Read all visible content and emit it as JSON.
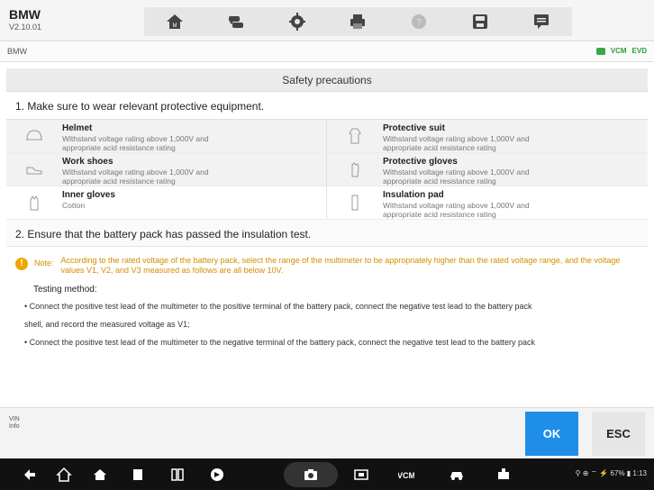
{
  "app": {
    "brand": "BMW",
    "version": "V2.10.01"
  },
  "breadcrumb": "BMW",
  "status": {
    "vci": "VCM",
    "evd": "EVD"
  },
  "toolbar": {
    "icons": [
      "home-icon",
      "vehicle-swap-icon",
      "settings-icon",
      "print-icon",
      "help-icon",
      "save-icon",
      "message-icon"
    ]
  },
  "dialog": {
    "title": "Safety precautions",
    "section1": "1. Make sure to wear relevant protective equipment.",
    "ppe": [
      {
        "title": "Helmet",
        "desc1": "Withstand voltage rating above 1,000V and",
        "desc2": "appropriate acid resistance rating"
      },
      {
        "title": "Protective suit",
        "desc1": "Withstand voltage rating above 1,000V and",
        "desc2": "appropriate acid resistance rating"
      },
      {
        "title": "Work shoes",
        "desc1": "Withstand voltage rating above 1,000V and",
        "desc2": "appropriate acid resistance rating"
      },
      {
        "title": "Protective gloves",
        "desc1": "Withstand voltage rating above 1,000V and",
        "desc2": "appropriate acid resistance rating"
      },
      {
        "title": "Inner gloves",
        "desc1": "Cotton",
        "desc2": ""
      },
      {
        "title": "Insulation pad",
        "desc1": "Withstand voltage rating above 1,000V and",
        "desc2": "appropriate acid resistance rating"
      }
    ],
    "section2": "2. Ensure that the battery pack has passed the insulation test.",
    "note_label": "Note:",
    "note_text": "According to the rated voltage of the battery pack, select the range of the multimeter to be appropriately higher than the rated voltage range, and the voltage values V1, V2, and V3 measured as follows are all below 10V.",
    "method_heading": "Testing method:",
    "step1a": "• Connect the positive test lead of the multimeter to the positive terminal of the battery pack, connect the negative test lead to the battery pack",
    "step1b": "shell, and record the measured voltage as V1;",
    "step2": "• Connect the positive test lead of the multimeter to the negative terminal of the battery pack, connect the negative test lead to the battery pack"
  },
  "footer": {
    "vin_label": "VIN",
    "info_label": "Info",
    "ok": "OK",
    "esc": "ESC"
  },
  "system": {
    "status": "⚲ ⊕ ⌔ ⚡ 67% ▮ 1:13"
  },
  "colors": {
    "accent": "#1f8ee8",
    "note": "#d09000",
    "status": "#3aa64b"
  }
}
